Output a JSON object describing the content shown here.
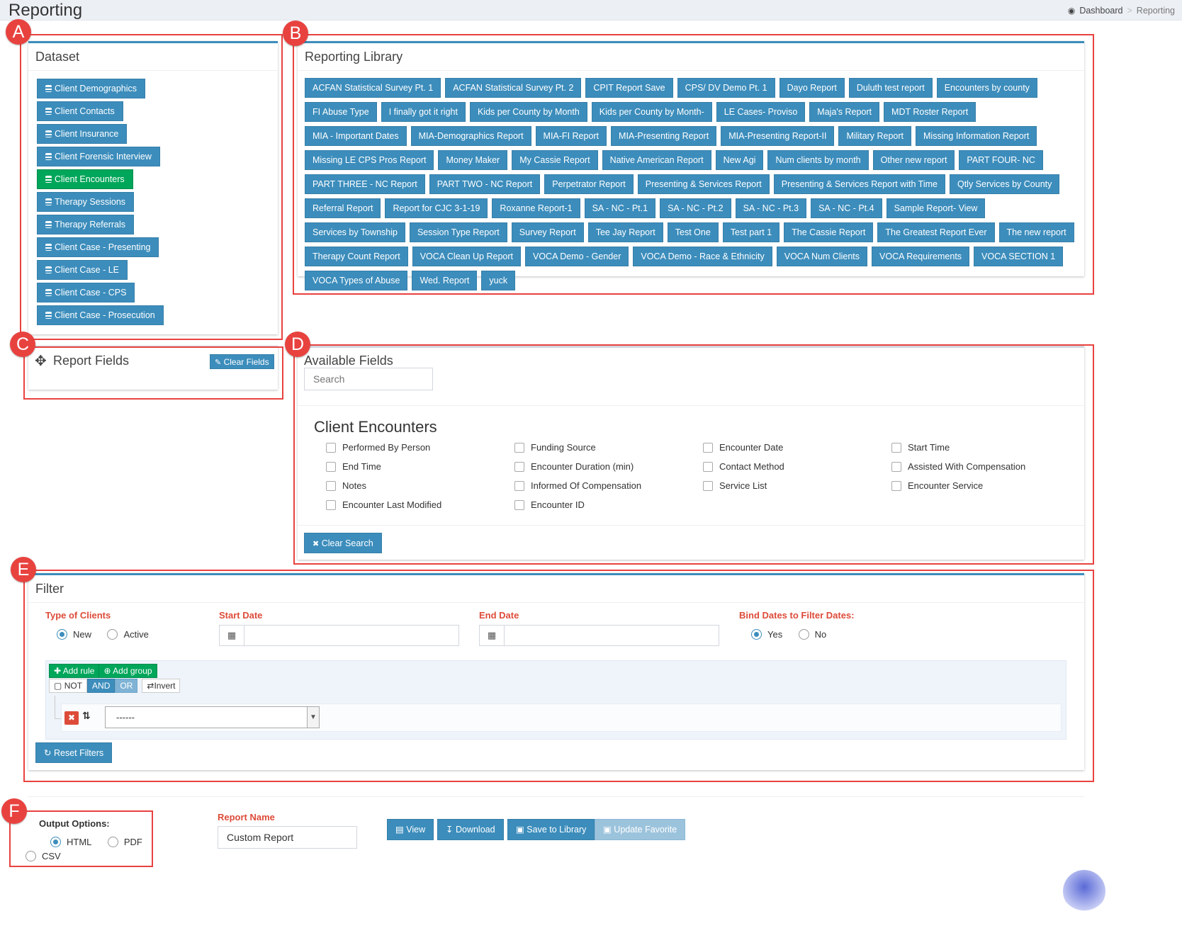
{
  "header": {
    "title": "Reporting",
    "breadcrumb": {
      "home": "Dashboard",
      "sep": ">",
      "current": "Reporting"
    }
  },
  "annotations": [
    "A",
    "B",
    "C",
    "D",
    "E",
    "F"
  ],
  "dataset": {
    "title": "Dataset",
    "items": [
      {
        "label": "Client Demographics",
        "active": false
      },
      {
        "label": "Client Contacts",
        "active": false
      },
      {
        "label": "Client Insurance",
        "active": false
      },
      {
        "label": "Client Forensic Interview",
        "active": false
      },
      {
        "label": "Client Encounters",
        "active": true
      },
      {
        "label": "Therapy Sessions",
        "active": false
      },
      {
        "label": "Therapy Referrals",
        "active": false
      },
      {
        "label": "Client Case - Presenting",
        "active": false
      },
      {
        "label": "Client Case - LE",
        "active": false
      },
      {
        "label": "Client Case - CPS",
        "active": false
      },
      {
        "label": "Client Case - Prosecution",
        "active": false
      }
    ]
  },
  "library": {
    "title": "Reporting Library",
    "items": [
      "ACFAN Statistical Survey Pt. 1",
      "ACFAN Statistical Survey Pt. 2",
      "CPIT Report Save",
      "CPS/ DV Demo Pt. 1",
      "Dayo Report",
      "Duluth test report",
      "Encounters by county",
      "FI Abuse Type",
      "I finally got it right",
      "Kids per County by Month",
      "Kids per County by Month-",
      "LE Cases- Proviso",
      "Maja's Report",
      "MDT Roster Report",
      "MIA - Important Dates",
      "MIA-Demographics Report",
      "MIA-FI Report",
      "MIA-Presenting Report",
      "MIA-Presenting Report-II",
      "Military Report",
      "Missing Information Report",
      "Missing LE CPS Pros Report",
      "Money Maker",
      "My Cassie Report",
      "Native American Report",
      "New Agi",
      "Num clients by month",
      "Other new report",
      "PART FOUR- NC",
      "PART THREE - NC Report",
      "PART TWO - NC Report",
      "Perpetrator Report",
      "Presenting & Services Report",
      "Presenting & Services Report with Time",
      "Qtly Services by County",
      "Referral Report",
      "Report for CJC 3-1-19",
      "Roxanne Report-1",
      "SA - NC - Pt.1",
      "SA - NC - Pt.2",
      "SA - NC - Pt.3",
      "SA - NC - Pt.4",
      "Sample Report- View",
      "Services by Township",
      "Session Type Report",
      "Survey Report",
      "Tee Jay Report",
      "Test One",
      "Test part 1",
      "The Cassie Report",
      "The Greatest Report Ever",
      "The new report",
      "Therapy Count Report",
      "VOCA Clean Up Report",
      "VOCA Demo - Gender",
      "VOCA Demo - Race & Ethnicity",
      "VOCA Num Clients",
      "VOCA Requirements",
      "VOCA SECTION 1",
      "VOCA Types of Abuse",
      "Wed. Report",
      "yuck"
    ]
  },
  "report_fields": {
    "title": "Report Fields",
    "clear_label": "Clear Fields"
  },
  "available_fields": {
    "title": "Available Fields",
    "search_placeholder": "Search",
    "group_title": "Client Encounters",
    "fields": [
      "Performed By Person",
      "Funding Source",
      "Encounter Date",
      "Start Time",
      "End Time",
      "Encounter Duration (min)",
      "Contact Method",
      "Assisted With Compensation",
      "Notes",
      "Informed Of Compensation",
      "Service List",
      "Encounter Service",
      "Encounter Last Modified",
      "Encounter ID"
    ],
    "clear_search_label": "Clear Search"
  },
  "filter": {
    "title": "Filter",
    "type_label": "Type of Clients",
    "type_options": [
      {
        "label": "New",
        "checked": true
      },
      {
        "label": "Active",
        "checked": false
      }
    ],
    "start_label": "Start Date",
    "end_label": "End Date",
    "bind_label": "Bind Dates to Filter Dates:",
    "bind_options": [
      {
        "label": "Yes",
        "checked": true
      },
      {
        "label": "No",
        "checked": false
      }
    ],
    "add_rule": "Add rule",
    "add_group": "Add group",
    "not_label": "NOT",
    "and_label": "AND",
    "or_label": "OR",
    "invert_label": "Invert",
    "select_value": "------",
    "reset_label": "Reset Filters"
  },
  "output": {
    "title": "Output Options:",
    "options": [
      {
        "label": "HTML",
        "checked": true
      },
      {
        "label": "PDF",
        "checked": false
      },
      {
        "label": "CSV",
        "checked": false
      }
    ],
    "report_name_label": "Report Name",
    "report_name_value": "Custom Report",
    "view_label": "View",
    "download_label": "Download",
    "save_label": "Save to Library",
    "update_label": "Update Favorite"
  },
  "colors": {
    "primary": "#3c8dbc",
    "success": "#00a65a",
    "danger": "#dd4b39",
    "annotation": "#e8423f"
  }
}
